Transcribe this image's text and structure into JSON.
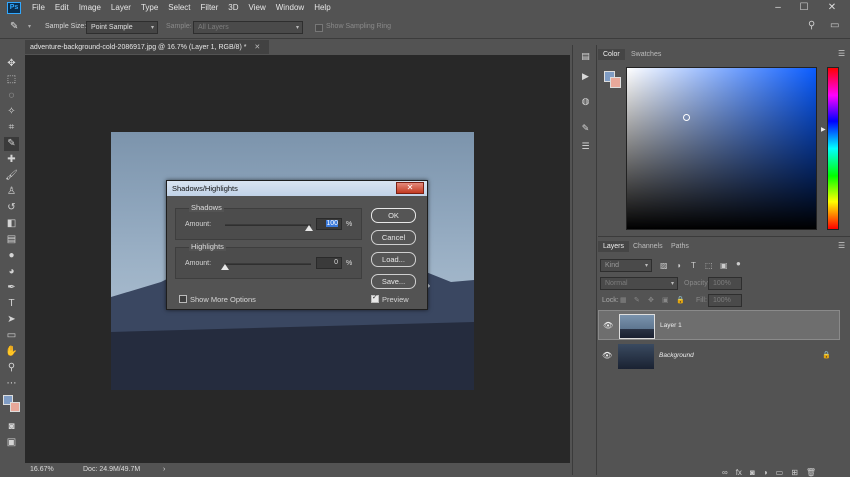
{
  "app": {
    "logo": "Ps"
  },
  "menu": [
    "File",
    "Edit",
    "Image",
    "Layer",
    "Type",
    "Select",
    "Filter",
    "3D",
    "View",
    "Window",
    "Help"
  ],
  "options": {
    "sample_size_label": "Sample Size:",
    "sample_size_value": "Point Sample",
    "sample_label": "Sample:",
    "sample_value": "All Layers",
    "show_ring": "Show Sampling Ring"
  },
  "document": {
    "tab_title": "adventure-background-cold-2086917.jpg @ 16.7% (Layer 1, RGB/8) *",
    "zoom": "16.67%",
    "doc_size": "Doc: 24.9M/49.7M"
  },
  "color_panel": {
    "tabs": [
      "Color",
      "Swatches"
    ],
    "accent": "#0a5cff"
  },
  "layers_panel": {
    "tabs": [
      "Layers",
      "Channels",
      "Paths"
    ],
    "kind_label": "Kind",
    "blend_mode": "Normal",
    "opacity_label": "Opacity:",
    "opacity_value": "100%",
    "lock_label": "Lock:",
    "fill_label": "Fill:",
    "fill_value": "100%",
    "layers": [
      {
        "name": "Layer 1",
        "selected": true
      },
      {
        "name": "Background",
        "selected": false
      }
    ]
  },
  "dialog": {
    "title": "Shadows/Highlights",
    "close": "✕",
    "shadows": {
      "title": "Shadows",
      "amount_label": "Amount:",
      "amount_value": "100",
      "unit": "%"
    },
    "highlights": {
      "title": "Highlights",
      "amount_label": "Amount:",
      "amount_value": "0",
      "unit": "%"
    },
    "buttons": {
      "ok": "OK",
      "cancel": "Cancel",
      "load": "Load...",
      "save": "Save..."
    },
    "show_more": "Show More Options",
    "preview": "Preview"
  }
}
